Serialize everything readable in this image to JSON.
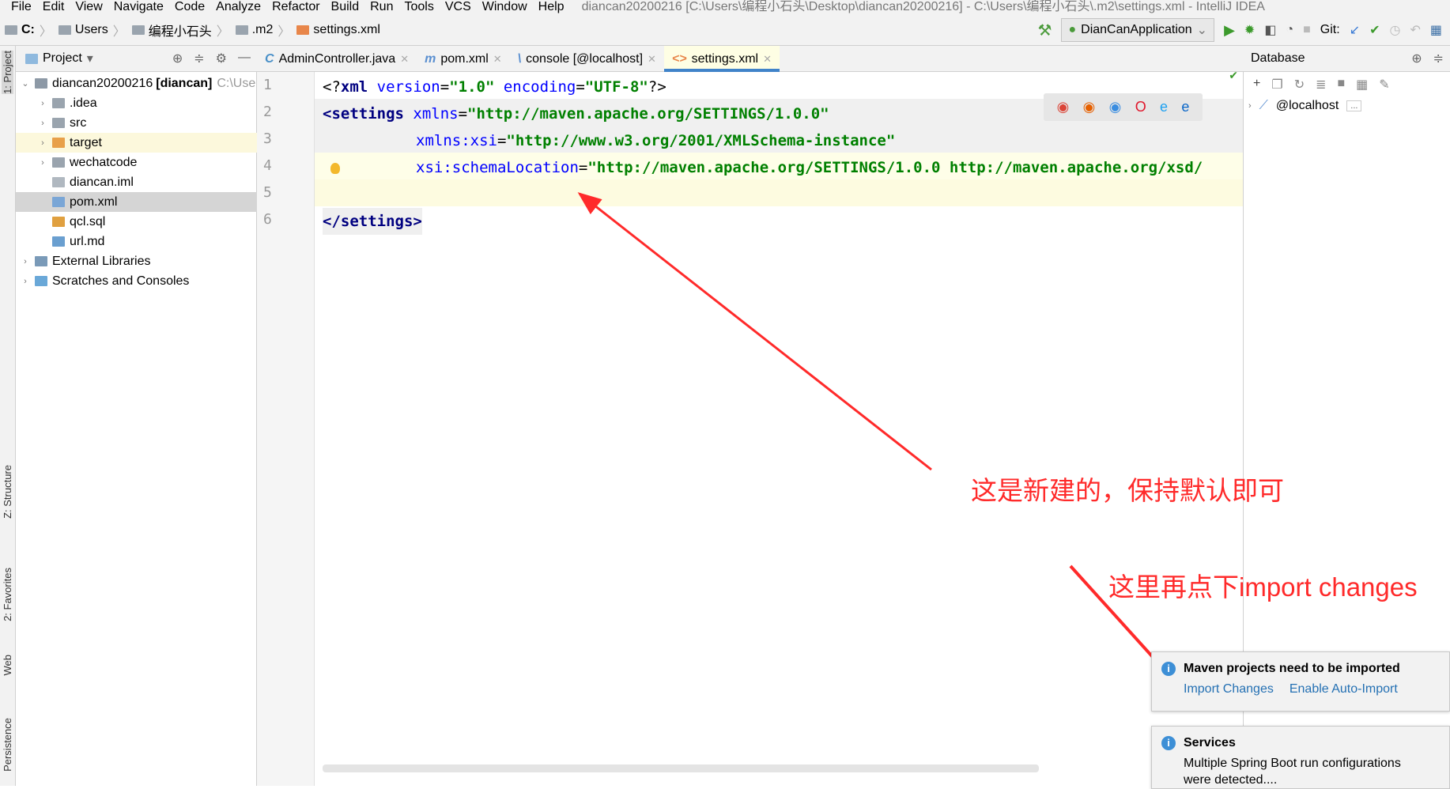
{
  "menu": [
    "File",
    "Edit",
    "View",
    "Navigate",
    "Code",
    "Analyze",
    "Refactor",
    "Build",
    "Run",
    "Tools",
    "VCS",
    "Window",
    "Help"
  ],
  "window_title": "diancan20200216 [C:\\Users\\编程小石头\\Desktop\\diancan20200216] - C:\\Users\\编程小石头\\.m2\\settings.xml - IntelliJ IDEA",
  "breadcrumb": [
    "C:",
    "Users",
    "编程小石头",
    ".m2",
    "settings.xml"
  ],
  "toolbar": {
    "run_config": "DianCanApplication",
    "git_label": "Git:"
  },
  "side_stripe": [
    "1: Project",
    "Z: Structure",
    "2: Favorites",
    "Web",
    "Persistence"
  ],
  "project": {
    "header": "Project",
    "items": [
      {
        "label": "diancan20200216",
        "bold": "[diancan]",
        "hint": "C:\\Use",
        "depth": 0,
        "arrow": "v",
        "icon": "module-folder-icon"
      },
      {
        "label": ".idea",
        "depth": 1,
        "arrow": ">",
        "icon": "folder-icon"
      },
      {
        "label": "src",
        "depth": 1,
        "arrow": ">",
        "icon": "folder-icon"
      },
      {
        "label": "target",
        "depth": 1,
        "arrow": ">",
        "icon": "folder-orange-icon"
      },
      {
        "label": "wechatcode",
        "depth": 1,
        "arrow": ">",
        "icon": "folder-icon"
      },
      {
        "label": "diancan.iml",
        "depth": 1,
        "arrow": "",
        "icon": "iml-file-icon"
      },
      {
        "label": "pom.xml",
        "depth": 1,
        "arrow": "",
        "icon": "maven-file-icon"
      },
      {
        "label": "qcl.sql",
        "depth": 1,
        "arrow": "",
        "icon": "sql-file-icon"
      },
      {
        "label": "url.md",
        "depth": 1,
        "arrow": "",
        "icon": "md-file-icon"
      },
      {
        "label": "External Libraries",
        "depth": 0,
        "arrow": ">",
        "icon": "library-icon"
      },
      {
        "label": "Scratches and Consoles",
        "depth": 0,
        "arrow": ">",
        "icon": "scratches-icon"
      }
    ]
  },
  "tabs": [
    {
      "label": "AdminController.java",
      "icon": "C"
    },
    {
      "label": "pom.xml",
      "icon": "m"
    },
    {
      "label": "console [@localhost]",
      "icon": "\\"
    },
    {
      "label": "settings.xml",
      "icon": "<>",
      "active": true
    }
  ],
  "code_lines": [
    "1",
    "2",
    "3",
    "4",
    "5",
    "6"
  ],
  "code": {
    "l1": [
      "<?",
      "xml",
      " version",
      "=",
      "\"1.0\"",
      " encoding",
      "=",
      "\"UTF-8\"",
      "?>"
    ],
    "l2": [
      "<settings",
      " xmlns",
      "=",
      "\"http://maven.apache.org/SETTINGS/1.0.0\""
    ],
    "l3": [
      "xmlns:xsi",
      "=",
      "\"http://www.w3.org/2001/XMLSchema-instance\""
    ],
    "l4": [
      "xsi:schemaLocation",
      "=",
      "\"http://maven.apache.org/SETTINGS/1.0.0 http://maven.apache.org/xsd/"
    ],
    "l6": "</settings>"
  },
  "database": {
    "header": "Database",
    "item": "@localhost",
    "more": "..."
  },
  "annotations": {
    "note1": "这是新建的，保持默认即可",
    "note2": "这里再点下import changes",
    "color": "#ff2a2a"
  },
  "notifications": [
    {
      "title": "Maven projects need to be imported",
      "links": [
        "Import Changes",
        "Enable Auto-Import"
      ]
    },
    {
      "title": "Services",
      "body": "Multiple Spring Boot run configurations were detected...."
    }
  ]
}
